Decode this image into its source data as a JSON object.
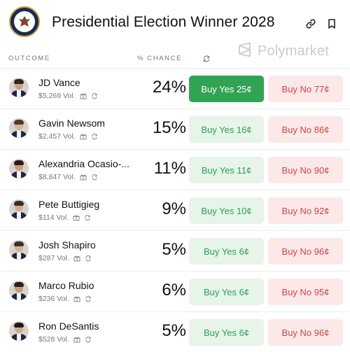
{
  "header": {
    "title": "Presidential Election Winner 2028",
    "link_icon": "link-icon",
    "bookmark_icon": "bookmark-icon",
    "seal_icon": "presidential-seal-icon"
  },
  "columns": {
    "outcome": "OUTCOME",
    "chance": "% CHANCE",
    "refresh_icon": "refresh-icon"
  },
  "brand": {
    "name": "Polymarket",
    "logo_icon": "polymarket-logo-icon"
  },
  "colors": {
    "yes_active_bg": "#31a355",
    "yes_bg": "#e6f4ea",
    "yes_text": "#2d9e52",
    "no_bg": "#fbe8e8",
    "no_text": "#d14444"
  },
  "outcomes": [
    {
      "name": "JD Vance",
      "volume": "$5,269 Vol.",
      "chance": "24%",
      "buy_yes": "Buy Yes 25¢",
      "buy_no": "Buy No 77¢",
      "yes_active": true
    },
    {
      "name": "Gavin Newsom",
      "volume": "$2,457 Vol.",
      "chance": "15%",
      "buy_yes": "Buy Yes 16¢",
      "buy_no": "Buy No 86¢",
      "yes_active": false
    },
    {
      "name": "Alexandria Ocasio-...",
      "volume": "$8,847 Vol.",
      "chance": "11%",
      "buy_yes": "Buy Yes 11¢",
      "buy_no": "Buy No 90¢",
      "yes_active": false
    },
    {
      "name": "Pete Buttigieg",
      "volume": "$114 Vol.",
      "chance": "9%",
      "buy_yes": "Buy Yes 10¢",
      "buy_no": "Buy No 92¢",
      "yes_active": false
    },
    {
      "name": "Josh Shapiro",
      "volume": "$287 Vol.",
      "chance": "5%",
      "buy_yes": "Buy Yes 6¢",
      "buy_no": "Buy No 96¢",
      "yes_active": false
    },
    {
      "name": "Marco Rubio",
      "volume": "$236 Vol.",
      "chance": "6%",
      "buy_yes": "Buy Yes 6¢",
      "buy_no": "Buy No 95¢",
      "yes_active": false
    },
    {
      "name": "Ron DeSantis",
      "volume": "$528 Vol.",
      "chance": "5%",
      "buy_yes": "Buy Yes 6¢",
      "buy_no": "Buy No 96¢",
      "yes_active": false
    }
  ]
}
